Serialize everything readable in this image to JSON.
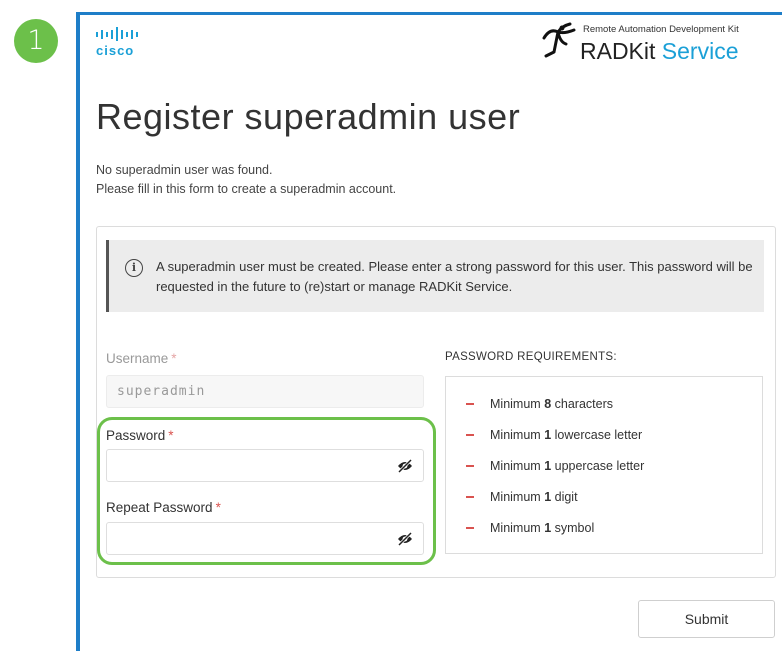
{
  "step_number": "1",
  "brand": {
    "cisco": "cisco",
    "tagline": "Remote Automation Development Kit",
    "product_main": "RADKit",
    "product_accent": "Service",
    "accent_color": "#1ba0d7"
  },
  "page": {
    "title": "Register superadmin user",
    "intro_line1": "No superadmin user was found.",
    "intro_line2": "Please fill in this form to create a superadmin account."
  },
  "alert": {
    "icon": "info-icon",
    "text": "A superadmin user must be created. Please enter a strong password for this user. This password will be requested in the future to (re)start or manage RADKit Service."
  },
  "form": {
    "username_label": "Username",
    "username_value": "superadmin",
    "password_label": "Password",
    "password_value": "",
    "repeat_password_label": "Repeat Password",
    "repeat_password_value": "",
    "required_mark": "*",
    "toggle_icon": "eye-slash-icon"
  },
  "requirements": {
    "heading": "PASSWORD REQUIREMENTS:",
    "items": [
      {
        "prefix": "Minimum",
        "value": "8",
        "suffix": "characters"
      },
      {
        "prefix": "Minimum",
        "value": "1",
        "suffix": "lowercase letter"
      },
      {
        "prefix": "Minimum",
        "value": "1",
        "suffix": "uppercase letter"
      },
      {
        "prefix": "Minimum",
        "value": "1",
        "suffix": "digit"
      },
      {
        "prefix": "Minimum",
        "value": "1",
        "suffix": "symbol"
      }
    ]
  },
  "submit_label": "Submit",
  "colors": {
    "highlight": "#6cc04a",
    "required": "#d9534f",
    "window_border": "#1e7ec8"
  }
}
